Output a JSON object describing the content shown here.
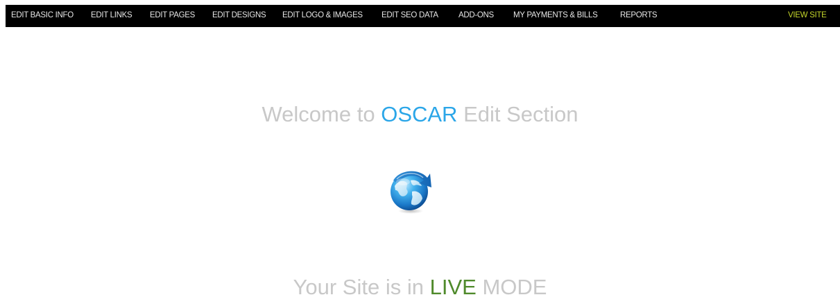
{
  "nav": {
    "items": [
      {
        "label": "EDIT BASIC INFO"
      },
      {
        "label": "EDIT LINKS"
      },
      {
        "label": "EDIT PAGES"
      },
      {
        "label": "EDIT DESIGNS"
      },
      {
        "label": "EDIT LOGO & IMAGES"
      },
      {
        "label": "EDIT SEO DATA"
      },
      {
        "label": "ADD-ONS"
      },
      {
        "label": "MY PAYMENTS & BILLS"
      },
      {
        "label": "REPORTS"
      }
    ],
    "view_site": "VIEW SITE"
  },
  "welcome": {
    "prefix": "Welcome to",
    "brand": "OSCAR",
    "suffix": "Edit Section"
  },
  "globe_icon": "globe-refresh-icon",
  "status": {
    "prefix": "Your Site is in",
    "mode": "LIVE",
    "suffix": "MODE"
  },
  "colors": {
    "nav_background": "#000000",
    "nav_text": "#e6e6e6",
    "view_site": "#c4d62a",
    "muted_text": "#c8c8c8",
    "brand": "#2ba6e8",
    "live": "#4f8a2b"
  }
}
